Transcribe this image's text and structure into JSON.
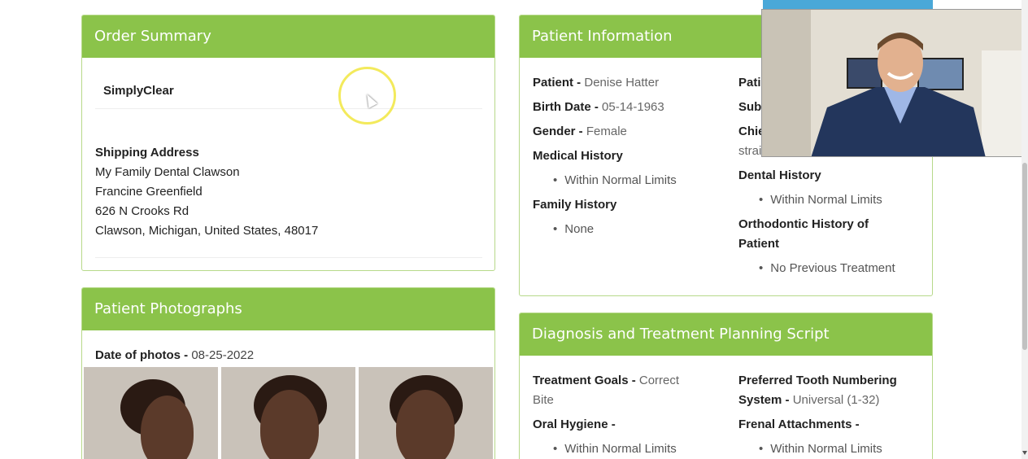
{
  "order_summary": {
    "title": "Order Summary",
    "product": "SimplyClear",
    "shipping_label": "Shipping Address",
    "address": [
      "My Family Dental Clawson",
      "Francine Greenfield",
      "626 N Crooks Rd",
      "Clawson, Michigan, United States, 48017"
    ]
  },
  "patient_info": {
    "title": "Patient Information",
    "patient_label": "Patient -",
    "patient_value": "Denise Hatter",
    "birth_label": "Birth Date -",
    "birth_value": "05-14-1963",
    "gender_label": "Gender -",
    "gender_value": "Female",
    "medical_label": "Medical History",
    "medical_items": [
      "Within Normal Limits"
    ],
    "family_label": "Family History",
    "family_items": [
      "None"
    ],
    "col2_partial_1": "Pati",
    "col2_partial_2": "Sub",
    "col2_partial_3": "Chie",
    "col2_partial_4": "straig",
    "dental_label": "Dental History",
    "dental_items": [
      "Within Normal Limits"
    ],
    "ortho_label_1": "Orthodontic History of",
    "ortho_label_2": "Patient",
    "ortho_items": [
      "No Previous Treatment"
    ]
  },
  "photographs": {
    "title": "Patient Photographs",
    "date_label": "Date of photos -",
    "date_value": "08-25-2022"
  },
  "diagnosis": {
    "title": "Diagnosis and Treatment Planning Script",
    "goals_label": "Treatment Goals -",
    "goals_value_1": "Correct",
    "goals_value_2": "Bite",
    "numbering_label_1": "Preferred Tooth Numbering",
    "numbering_label_2": "System -",
    "numbering_value": "Universal (1-32)",
    "hygiene_label": "Oral Hygiene -",
    "hygiene_items": [
      "Within Normal Limits"
    ],
    "frenal_label": "Frenal Attachments -",
    "frenal_items": [
      "Within Normal Limits"
    ]
  },
  "colors": {
    "panel_header": "#8bc34a",
    "panel_border": "#b7d98a",
    "cursor_ring": "#f3ea5c"
  }
}
